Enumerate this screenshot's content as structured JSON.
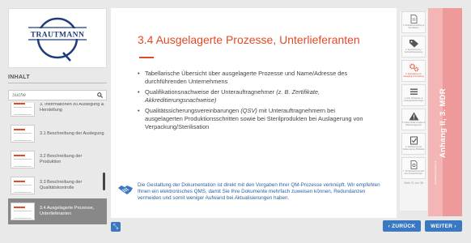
{
  "logo": {
    "text": "TRAUTMANN"
  },
  "sidebar": {
    "heading": "INHALT",
    "search_placeholder": "Suche",
    "toc": [
      {
        "label": "3. Informationen zu Auslegung & Herstellung"
      },
      {
        "label": "3.1 Beschreibung der Auslegung"
      },
      {
        "label": "3.2 Beschreibung der Produktion"
      },
      {
        "label": "3.3 Beschreibung der Qualitätskontrolle"
      },
      {
        "label": "3.4 Ausgelagerte Prozesse, Unterlieferanten",
        "active": true
      }
    ]
  },
  "main": {
    "title": "3.4 Ausgelagerte Prozesse, Unterlieferanten",
    "bullet1": "Tabellarische Übersicht über ausgelagerte Prozesse und Name/Adresse des durchführenden Unternehmens",
    "bullet2_prefix": "Qualifikationsnachweise der Unterauftragnehmer ",
    "bullet2_italic": "(z. B. Zertifikate, Akkreditierungsnachweise)",
    "bullet3_prefix": "Qualitätssicherungsvereinbarungen ",
    "bullet3_italic": "(QSV)",
    "bullet3_suffix": " mit Unterauftragnehmern bei ausgelagerten Produktionsschritten sowie bei Sterilprodukten bei Auslagerung von Verpackung/Sterilisation",
    "info": "Die Gestaltung der Dokumentation ist direkt mit den Vorgaben Ihrer QM-Prozesse verknüpft. Wir empfehlen Ihnen ein elektronisches QMS, damit Sie Ihre Dokumente mehrfach zuweisen können, Redundanzen vermeiden und somit weniger Aufwand bei Aktualisierungen haben."
  },
  "iconcol": {
    "items": [
      {
        "icon": "document-icon",
        "label": "1. Produktbeschreibung & Spezifikation"
      },
      {
        "icon": "tags-icon",
        "label": "2. Kennzeichnung / Gebrauchsanweisung"
      },
      {
        "icon": "gears-icon",
        "label": "3. Informationen zu Auslegung & Herstellung",
        "active": true
      },
      {
        "icon": "list-icon",
        "label": "4. Grdl. Sicherheits- & Leistungsanforderungen"
      },
      {
        "icon": "warning-icon",
        "label": "5. Nutzen-Risiko-Analyse & Risikomanagement"
      },
      {
        "icon": "checkbox-icon",
        "label": "6. Verifizierung und Validierung des Produktes"
      },
      {
        "icon": "document-search-icon",
        "label": "7. TD Überwachung nach dem Inverkehrbringen"
      }
    ],
    "page_count": "Seite 21 von 38"
  },
  "vtab": {
    "label": "Anhang II, 3. MDR",
    "small": "Qualitätsmanagement"
  },
  "nav": {
    "back": "‹ ZURÜCK",
    "next": "WEITER ›"
  },
  "colors": {
    "accent": "#e04a26",
    "button": "#3b78c2",
    "tab": "#ef9a9a",
    "info_text": "#2e5f9e"
  }
}
